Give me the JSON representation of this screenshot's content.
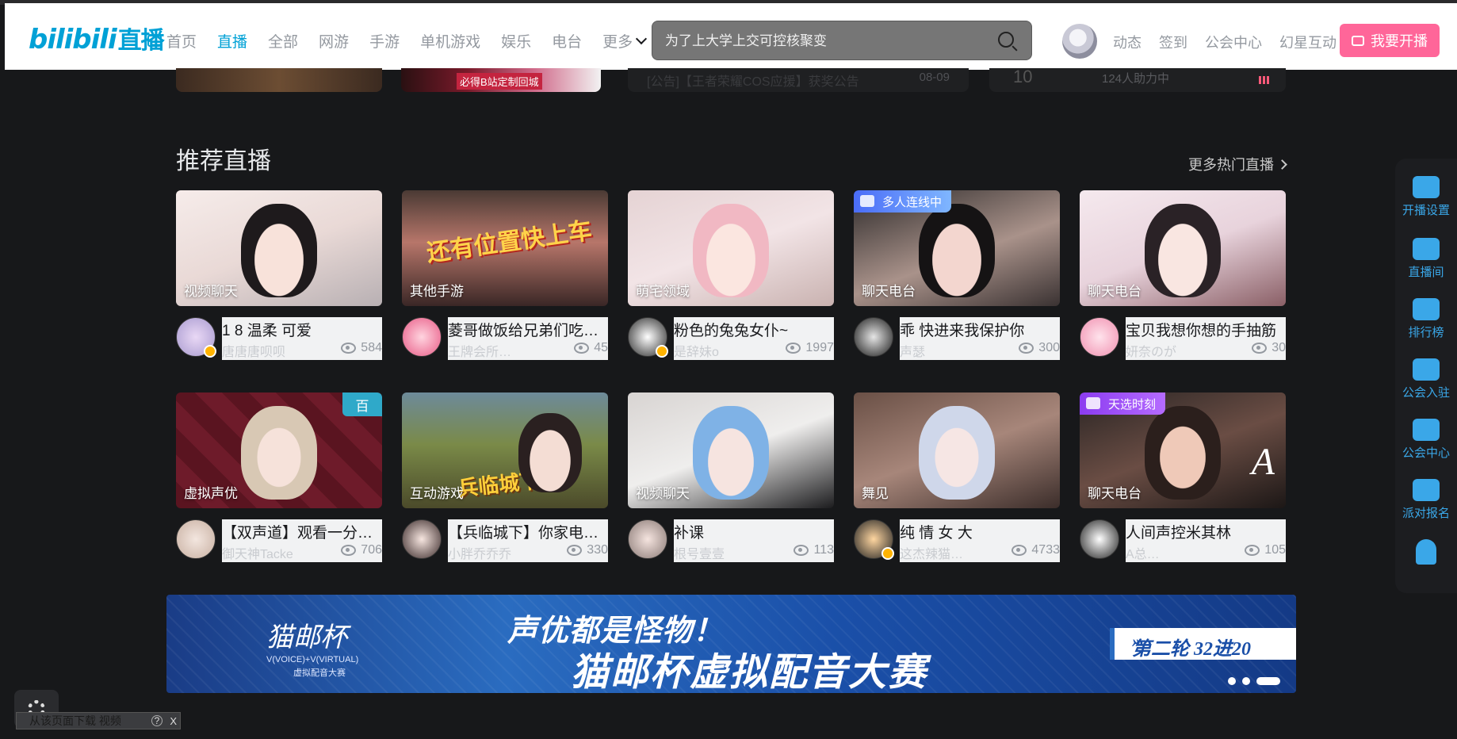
{
  "header": {
    "logo_text": "bilibili",
    "logo_live": "直播",
    "nav": [
      {
        "label": "首页"
      },
      {
        "label": "直播"
      },
      {
        "label": "全部"
      },
      {
        "label": "网游"
      },
      {
        "label": "手游"
      },
      {
        "label": "单机游戏"
      },
      {
        "label": "娱乐"
      },
      {
        "label": "电台"
      },
      {
        "label": "更多"
      }
    ],
    "active_nav": "直播",
    "search_placeholder": "为了上大学上交可控核聚变",
    "links": [
      "动态",
      "签到",
      "公会中心",
      "幻星互动"
    ],
    "start_button": "我要开播",
    "accent_color": "#00a1d6",
    "pink_color": "#ff6699"
  },
  "top_strip": {
    "promo_tag": "必得B站定制回城",
    "notice_title": "[公告]【王者荣耀COS应援】获奖公告",
    "notice_date": "08-09",
    "rank_num": "10",
    "helpers": "124人助力中"
  },
  "section": {
    "title": "推荐直播",
    "more_label": "更多热门直播"
  },
  "rooms": [
    {
      "category": "视频聊天",
      "title": "1 8 温柔 可爱",
      "anchor": "唐唐唐呗呗",
      "viewers": "584"
    },
    {
      "category": "其他手游",
      "title": "菱哥做饭给兄弟们吃…",
      "anchor": "王牌会所…",
      "viewers": "45",
      "thumb_text": "还有位置快上车"
    },
    {
      "category": "萌宅领域",
      "title": "粉色的兔兔女仆~",
      "anchor": "是辞妹o",
      "viewers": "1997"
    },
    {
      "category": "聊天电台",
      "title": "乖 快进来我保护你",
      "anchor": "声瑟",
      "viewers": "300",
      "badge": "多人连线中"
    },
    {
      "category": "聊天电台",
      "title": "宝贝我想你想的手抽筋",
      "anchor": "妍奈のが",
      "viewers": "30"
    },
    {
      "category": "虚拟声优",
      "title": "【双声道】观看一分…",
      "anchor": "御天神Tacke",
      "viewers": "706",
      "corner": "百"
    },
    {
      "category": "互动游戏",
      "title": "【兵临城下】你家电…",
      "anchor": "小胖乔乔乔",
      "viewers": "330",
      "thumb_text": "兵临城下"
    },
    {
      "category": "视频聊天",
      "title": "补课",
      "anchor": "根号壹壹",
      "viewers": "113"
    },
    {
      "category": "舞见",
      "title": "纯 情 女 大",
      "anchor": "这杰辣猫…",
      "viewers": "4733"
    },
    {
      "category": "聊天电台",
      "title": "人间声控米其林",
      "anchor": "A总…",
      "viewers": "105",
      "badge": "天选时刻"
    }
  ],
  "banner": {
    "logo": "猫邮杯",
    "sub1": "V(VOICE)+V(VIRTUAL)",
    "sub2": "虚拟配音大赛",
    "line1": "声优都是怪物！",
    "line2": "猫邮杯虚拟配音大赛",
    "round": "第二轮 32进20",
    "arrow": "»"
  },
  "sidebar": [
    {
      "label": "开播设置",
      "icon": "camera-icon"
    },
    {
      "label": "直播间",
      "icon": "tv-icon"
    },
    {
      "label": "排行榜",
      "icon": "rank-icon"
    },
    {
      "label": "公会入驻",
      "icon": "home-icon"
    },
    {
      "label": "公会中心",
      "icon": "handshake-icon"
    },
    {
      "label": "派对报名",
      "icon": "sparkle-icon"
    },
    {
      "label": "",
      "icon": "rocket-icon"
    }
  ],
  "bottom": {
    "download_text": "从该页面下载 视频",
    "help": "?",
    "close": "X"
  }
}
